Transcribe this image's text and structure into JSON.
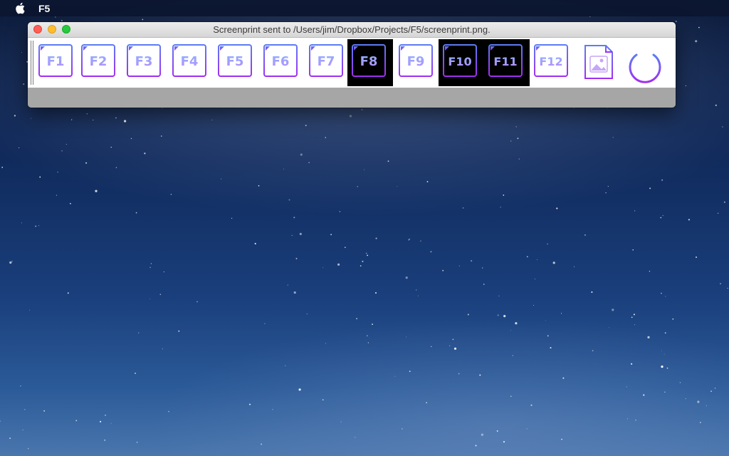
{
  "menubar": {
    "apple_icon": "apple-icon",
    "app_name": "F5"
  },
  "window": {
    "title": "Screenprint sent to /Users/jim/Dropbox/Projects/F5/screenprint.png.",
    "controls": [
      "close",
      "minimize",
      "zoom"
    ]
  },
  "toolbar": {
    "keys": [
      {
        "label": "F1",
        "active": false
      },
      {
        "label": "F2",
        "active": false
      },
      {
        "label": "F3",
        "active": false
      },
      {
        "label": "F4",
        "active": false
      },
      {
        "label": "F5",
        "active": false
      },
      {
        "label": "F6",
        "active": false
      },
      {
        "label": "F7",
        "active": false
      },
      {
        "label": "F8",
        "active": true
      },
      {
        "label": "F9",
        "active": false
      },
      {
        "label": "F10",
        "active": true
      },
      {
        "label": "F11",
        "active": true
      },
      {
        "label": "F12",
        "active": false
      }
    ],
    "image_icon": "image-file-icon",
    "power_icon": "power-icon"
  },
  "colors": {
    "icon_gradient_start": "#5d7cf4",
    "icon_gradient_end": "#a02ff0",
    "active_background": "#000000"
  }
}
